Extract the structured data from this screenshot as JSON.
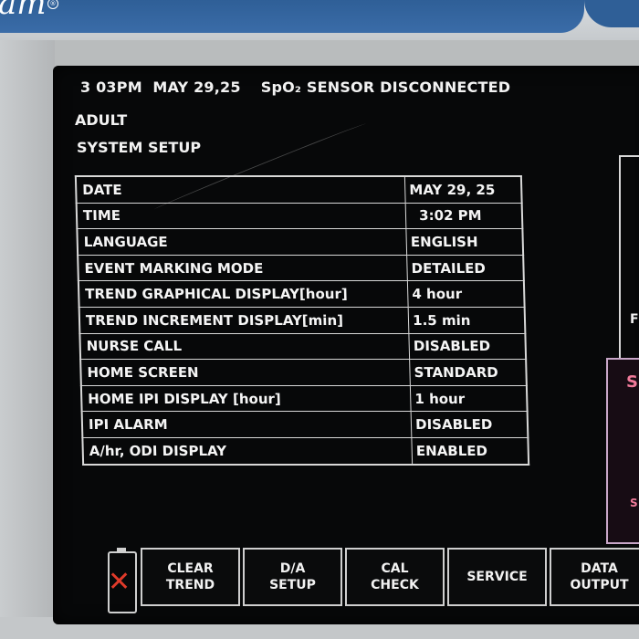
{
  "device": {
    "brand_text": "am",
    "registered_mark": "®"
  },
  "header": {
    "time": "3 03PM",
    "date": "MAY 29,25",
    "alert": "SpO₂ SENSOR DISCONNECTED",
    "patient_mode": "ADULT",
    "screen_title": "SYSTEM SETUP"
  },
  "setup": {
    "rows": [
      {
        "label": "DATE",
        "value": "MAY 29, 25"
      },
      {
        "label": "TIME",
        "value": "3:02 PM"
      },
      {
        "label": "LANGUAGE",
        "value": "ENGLISH"
      },
      {
        "label": "EVENT MARKING MODE",
        "value": "DETAILED"
      },
      {
        "label": "TREND GRAPHICAL DISPLAY[hour]",
        "value": "4 hour"
      },
      {
        "label": "TREND INCREMENT DISPLAY[min]",
        "value": "1.5 min"
      },
      {
        "label": "NURSE CALL",
        "value": "DISABLED"
      },
      {
        "label": "HOME SCREEN",
        "value": "STANDARD"
      },
      {
        "label": "HOME IPI DISPLAY [hour]",
        "value": "1 hour"
      },
      {
        "label": "IPI ALARM",
        "value": "DISABLED"
      },
      {
        "label": "A/hr, ODI DISPLAY",
        "value": "ENABLED"
      }
    ]
  },
  "side_panels": {
    "panel_letter": "F",
    "alarm_letter": "S",
    "alarm_small": "S"
  },
  "softkeys": [
    {
      "line1": "CLEAR",
      "line2": "TREND"
    },
    {
      "line1": "D/A",
      "line2": "SETUP"
    },
    {
      "line1": "CAL",
      "line2": "CHECK"
    },
    {
      "line1": "SERVICE",
      "line2": ""
    },
    {
      "line1": "DATA",
      "line2": "OUTPUT"
    }
  ],
  "battery": {
    "icon": "battery-empty-icon",
    "status_color": "#e03a2a"
  }
}
